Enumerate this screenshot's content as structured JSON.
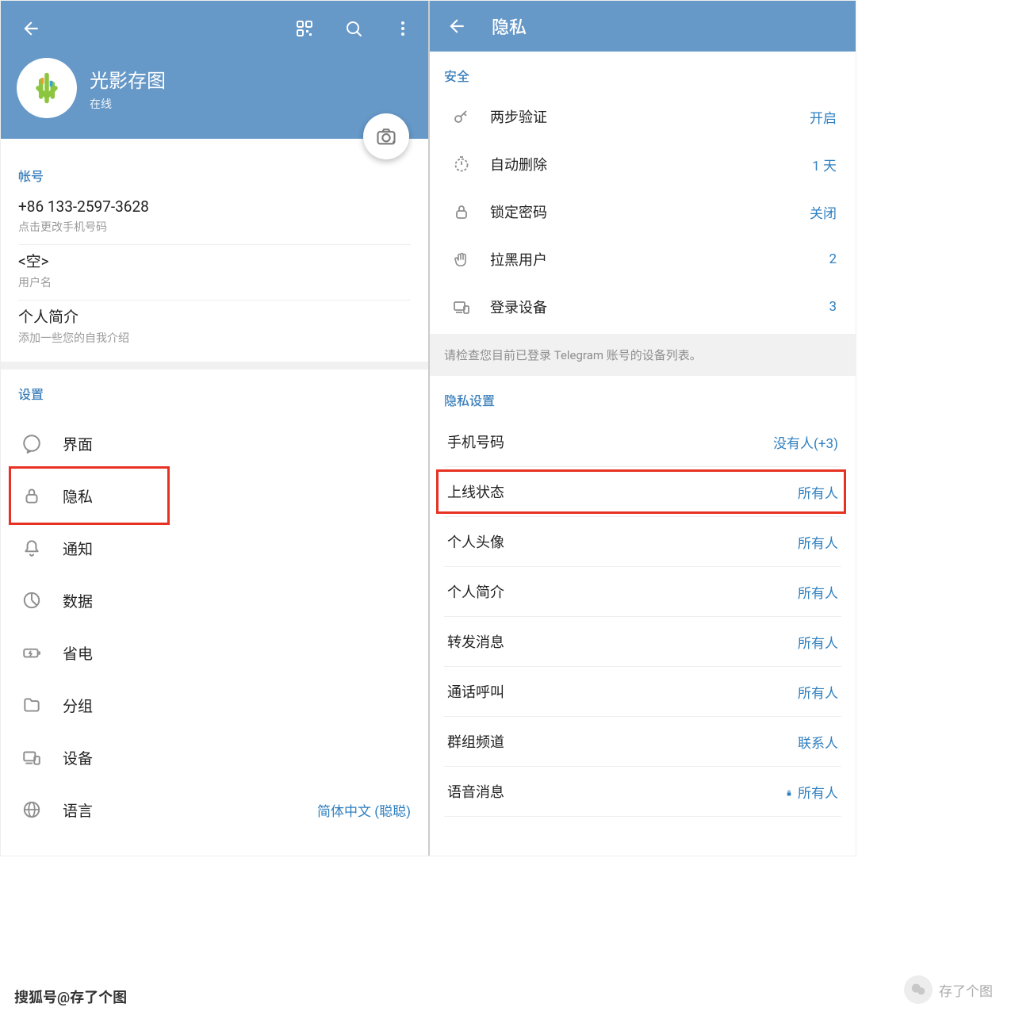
{
  "left": {
    "profile_name": "光影存图",
    "profile_status": "在线",
    "account_section": "帐号",
    "phone": "+86 133-2597-3628",
    "phone_sub": "点击更改手机号码",
    "username_value": "<空>",
    "username_sub": "用户名",
    "bio_label": "个人简介",
    "bio_sub": "添加一些您的自我介绍",
    "settings_section": "设置",
    "menu": [
      {
        "label": "界面",
        "icon": "chat-icon"
      },
      {
        "label": "隐私",
        "icon": "lock-icon",
        "highlight": true
      },
      {
        "label": "通知",
        "icon": "bell-icon"
      },
      {
        "label": "数据",
        "icon": "pie-icon"
      },
      {
        "label": "省电",
        "icon": "battery-icon"
      },
      {
        "label": "分组",
        "icon": "folder-icon"
      },
      {
        "label": "设备",
        "icon": "devices-icon"
      },
      {
        "label": "语言",
        "icon": "globe-icon",
        "value": "简体中文 (聪聪)"
      }
    ]
  },
  "right": {
    "title": "隐私",
    "security_section": "安全",
    "security_items": [
      {
        "label": "两步验证",
        "value": "开启",
        "icon": "key-icon"
      },
      {
        "label": "自动删除",
        "value": "1 天",
        "icon": "timer-icon"
      },
      {
        "label": "锁定密码",
        "value": "关闭",
        "icon": "lock-icon"
      },
      {
        "label": "拉黑用户",
        "value": "2",
        "icon": "hand-icon"
      },
      {
        "label": "登录设备",
        "value": "3",
        "icon": "devices-icon"
      }
    ],
    "security_note": "请检查您目前已登录 Telegram 账号的设备列表。",
    "privacy_section": "隐私设置",
    "privacy_items": [
      {
        "label": "手机号码",
        "value": "没有人(+3)"
      },
      {
        "label": "上线状态",
        "value": "所有人",
        "highlight": true
      },
      {
        "label": "个人头像",
        "value": "所有人"
      },
      {
        "label": "个人简介",
        "value": "所有人"
      },
      {
        "label": "转发消息",
        "value": "所有人"
      },
      {
        "label": "通话呼叫",
        "value": "所有人"
      },
      {
        "label": "群组频道",
        "value": "联系人"
      },
      {
        "label": "语音消息",
        "value": "所有人",
        "locked": true
      }
    ]
  },
  "footer": {
    "source": "搜狐号@存了个图",
    "wechat": "存了个图"
  },
  "colors": {
    "accent": "#6698c8",
    "link": "#2f7fbf",
    "highlight": "#e73223"
  }
}
